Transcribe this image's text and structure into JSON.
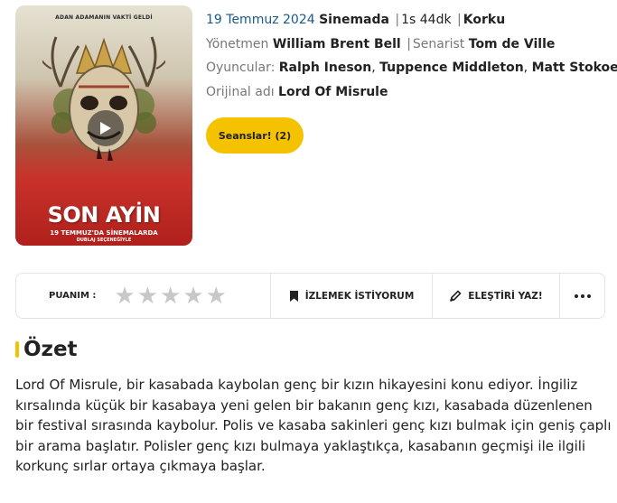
{
  "poster": {
    "tagline": "ADAN ADAMANIN VAKTİ GELDİ",
    "title": "SON AYİN",
    "release_line": "19 TEMMUZ'DA SİNEMALARDA",
    "dub_line": "DUBLAJ SEÇENEĞİYLE"
  },
  "movie": {
    "release_date": "19 Temmuz 2024",
    "status": "Sinemada",
    "duration": "1s 44dk",
    "genre": "Korku",
    "director_label": "Yönetmen",
    "director": "William Brent Bell",
    "writer_label": "Senarist",
    "writer": "Tom de Ville",
    "cast_label": "Oyuncular:",
    "cast": [
      "Ralph Ineson",
      "Tuppence Middleton",
      "Matt Stokoe"
    ],
    "original_title_label": "Orijinal adı",
    "original_title": "Lord Of Misrule"
  },
  "showtimes_button": "Seanslar! (2)",
  "actions": {
    "rating_label": "PUANIM :",
    "rating_value": 0,
    "rating_max": 5,
    "watchlist_label": "İZLEMEK İSTİYORUM",
    "review_label": "ELEŞTİRİ YAZ!"
  },
  "summary": {
    "heading": "Özet",
    "text": "Lord Of Misrule, bir kasabada kaybolan genç bir kızın hikayesini konu ediyor. İngiliz kırsalında küçük bir kasabaya yeni gelen bir bakanın genç kızı, kasabada düzenlenen bir festival sırasında kaybolur. Polis ve kasaba sakinleri genç kızı bulmak için geniş çaplı bir arama başlatır. Polisler genç kızı bulmaya yaklaştıkça, kasabanın geçmişi ile ilgili korkunç sırlar ortaya çıkmaya başlar."
  },
  "colors": {
    "accent": "#f5c200",
    "link_blue": "#1a5a8a",
    "muted": "#777777",
    "star_empty": "#c8c8c8"
  },
  "icons": [
    "play-icon",
    "bookmark-icon",
    "pencil-icon",
    "more-icon",
    "star-icon"
  ]
}
